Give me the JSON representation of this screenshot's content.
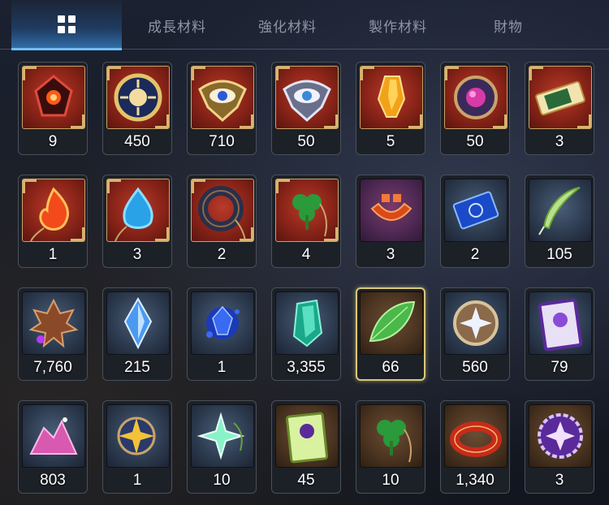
{
  "tabs": [
    {
      "id": "all",
      "label": "",
      "icon": "grid-icon",
      "active": true
    },
    {
      "id": "growth",
      "label": "成長材料",
      "active": false
    },
    {
      "id": "enhance",
      "label": "強化材料",
      "active": false
    },
    {
      "id": "craft",
      "label": "製作材料",
      "active": false
    },
    {
      "id": "treasure",
      "label": "財物",
      "active": false
    }
  ],
  "items": [
    {
      "count": "9",
      "icon": "red-crest-icon",
      "bg": "red"
    },
    {
      "count": "450",
      "icon": "golden-sun-medallion-icon",
      "bg": "red"
    },
    {
      "count": "710",
      "icon": "golden-eye-emblem-icon",
      "bg": "red"
    },
    {
      "count": "50",
      "icon": "silver-eye-emblem-icon",
      "bg": "red"
    },
    {
      "count": "5",
      "icon": "amber-crystal-icon",
      "bg": "red"
    },
    {
      "count": "50",
      "icon": "purple-orb-coin-icon",
      "bg": "red"
    },
    {
      "count": "3",
      "icon": "golden-ticket-icon",
      "bg": "red"
    },
    {
      "count": "1",
      "icon": "fire-pendant-icon",
      "bg": "red"
    },
    {
      "count": "3",
      "icon": "water-drop-pendant-icon",
      "bg": "red"
    },
    {
      "count": "2",
      "icon": "dark-ring-pendant-icon",
      "bg": "red"
    },
    {
      "count": "4",
      "icon": "clover-pendant-icon",
      "bg": "red"
    },
    {
      "count": "3",
      "icon": "orange-crest-pendant-icon",
      "bg": "purple"
    },
    {
      "count": "2",
      "icon": "blue-ticket-icon",
      "bg": "blue"
    },
    {
      "count": "105",
      "icon": "green-feather-icon",
      "bg": "blue"
    },
    {
      "count": "7,760",
      "icon": "purple-maple-leaf-icon",
      "bg": "blue"
    },
    {
      "count": "215",
      "icon": "blue-crystal-shard-icon",
      "bg": "blue"
    },
    {
      "count": "1",
      "icon": "blue-gem-cluster-icon",
      "bg": "blue"
    },
    {
      "count": "3,355",
      "icon": "teal-crystal-icon",
      "bg": "blue"
    },
    {
      "count": "66",
      "icon": "green-leaf-icon",
      "bg": "brown",
      "selected": true
    },
    {
      "count": "560",
      "icon": "silver-star-coin-icon",
      "bg": "blue"
    },
    {
      "count": "79",
      "icon": "purple-card-icon",
      "bg": "blue"
    },
    {
      "count": "803",
      "icon": "pink-ore-pile-icon",
      "bg": "blue"
    },
    {
      "count": "1",
      "icon": "gold-star-pendant-icon",
      "bg": "blue"
    },
    {
      "count": "10",
      "icon": "silver-star-pendant-icon",
      "bg": "blue"
    },
    {
      "count": "45",
      "icon": "green-card-icon",
      "bg": "brown"
    },
    {
      "count": "10",
      "icon": "clover-pendant-icon",
      "bg": "brown"
    },
    {
      "count": "1,340",
      "icon": "red-bracelet-icon",
      "bg": "brown"
    },
    {
      "count": "3",
      "icon": "purple-seal-icon",
      "bg": "brown"
    }
  ]
}
